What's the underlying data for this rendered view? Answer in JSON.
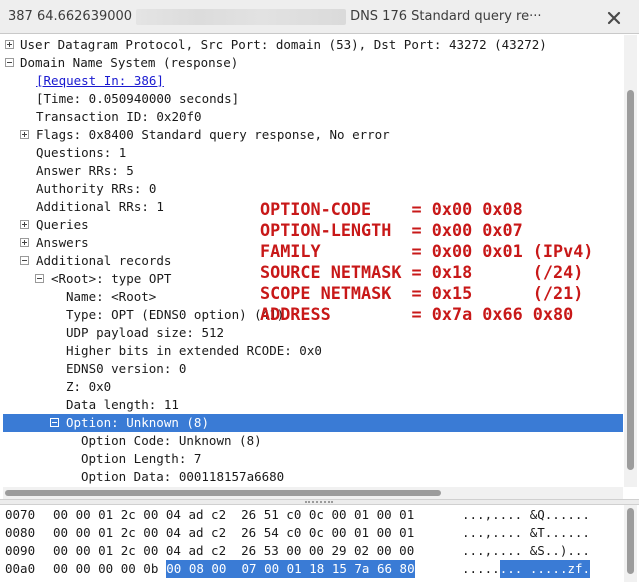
{
  "window": {
    "title_left": "387 64.662639000",
    "title_right": "DNS 176 Standard query re···"
  },
  "tree": [
    {
      "text": "User Datagram Protocol, Src Port: domain (53), Dst Port: 43272 (43272)",
      "indent": 0,
      "expander": "plus",
      "link": false,
      "selected": false
    },
    {
      "text": "Domain Name System (response)",
      "indent": 0,
      "expander": "minus",
      "link": false,
      "selected": false
    },
    {
      "text": "[Request In: 386]",
      "indent": 1,
      "expander": "none",
      "link": true,
      "selected": false
    },
    {
      "text": "[Time: 0.050940000 seconds]",
      "indent": 1,
      "expander": "none",
      "link": false,
      "selected": false
    },
    {
      "text": "Transaction ID: 0x20f0",
      "indent": 1,
      "expander": "none",
      "link": false,
      "selected": false
    },
    {
      "text": "Flags: 0x8400 Standard query response, No error",
      "indent": 1,
      "expander": "plus",
      "link": false,
      "selected": false
    },
    {
      "text": "Questions: 1",
      "indent": 1,
      "expander": "none",
      "link": false,
      "selected": false
    },
    {
      "text": "Answer RRs: 5",
      "indent": 1,
      "expander": "none",
      "link": false,
      "selected": false
    },
    {
      "text": "Authority RRs: 0",
      "indent": 1,
      "expander": "none",
      "link": false,
      "selected": false
    },
    {
      "text": "Additional RRs: 1",
      "indent": 1,
      "expander": "none",
      "link": false,
      "selected": false
    },
    {
      "text": "Queries",
      "indent": 1,
      "expander": "plus",
      "link": false,
      "selected": false
    },
    {
      "text": "Answers",
      "indent": 1,
      "expander": "plus",
      "link": false,
      "selected": false
    },
    {
      "text": "Additional records",
      "indent": 1,
      "expander": "minus",
      "link": false,
      "selected": false
    },
    {
      "text": "<Root>: type OPT",
      "indent": 2,
      "expander": "minus",
      "link": false,
      "selected": false
    },
    {
      "text": "Name: <Root>",
      "indent": 3,
      "expander": "none",
      "link": false,
      "selected": false
    },
    {
      "text": "Type: OPT (EDNS0 option) (41)",
      "indent": 3,
      "expander": "none",
      "link": false,
      "selected": false
    },
    {
      "text": "UDP payload size: 512",
      "indent": 3,
      "expander": "none",
      "link": false,
      "selected": false
    },
    {
      "text": "Higher bits in extended RCODE: 0x0",
      "indent": 3,
      "expander": "none",
      "link": false,
      "selected": false
    },
    {
      "text": "EDNS0 version: 0",
      "indent": 3,
      "expander": "none",
      "link": false,
      "selected": false
    },
    {
      "text": "Z: 0x0",
      "indent": 3,
      "expander": "none",
      "link": false,
      "selected": false
    },
    {
      "text": "Data length: 11",
      "indent": 3,
      "expander": "none",
      "link": false,
      "selected": false
    },
    {
      "text": "Option: Unknown (8)",
      "indent": 3,
      "expander": "minus",
      "link": false,
      "selected": true
    },
    {
      "text": "Option Code: Unknown (8)",
      "indent": 4,
      "expander": "none",
      "link": false,
      "selected": false
    },
    {
      "text": "Option Length: 7",
      "indent": 4,
      "expander": "none",
      "link": false,
      "selected": false
    },
    {
      "text": "Option Data: 000118157a6680",
      "indent": 4,
      "expander": "none",
      "link": false,
      "selected": false
    }
  ],
  "annotation": [
    "OPTION-CODE    = 0x00 0x08",
    "OPTION-LENGTH  = 0x00 0x07",
    "FAMILY         = 0x00 0x01 (IPv4)",
    "SOURCE NETMASK = 0x18      (/24)",
    "SCOPE NETMASK  = 0x15      (/21)",
    "ADDRESS        = 0x7a 0x66 0x80"
  ],
  "hex_dump": [
    {
      "offset": "0070",
      "hex_plain": "00 00 01 2c 00 04 ad c2  26 51 c0 0c 00 01 00 01",
      "hex_selected": "",
      "ascii_plain": "...,.... &Q......",
      "ascii_selected": ""
    },
    {
      "offset": "0080",
      "hex_plain": "00 00 01 2c 00 04 ad c2  26 54 c0 0c 00 01 00 01",
      "hex_selected": "",
      "ascii_plain": "...,.... &T......",
      "ascii_selected": ""
    },
    {
      "offset": "0090",
      "hex_plain": "00 00 01 2c 00 04 ad c2  26 53 00 00 29 02 00 00",
      "hex_selected": "",
      "ascii_plain": "...,.... &S..)...",
      "ascii_selected": ""
    },
    {
      "offset": "00a0",
      "hex_plain": "00 00 00 00 0b ",
      "hex_selected": "00 08 00  07 00 01 18 15 7a 66 80",
      "ascii_plain": ".....",
      "ascii_selected": "... .....zf."
    }
  ],
  "colors": {
    "selection": "#3a7bd5",
    "annotation": "#c81818",
    "link": "#1a1ad0"
  }
}
